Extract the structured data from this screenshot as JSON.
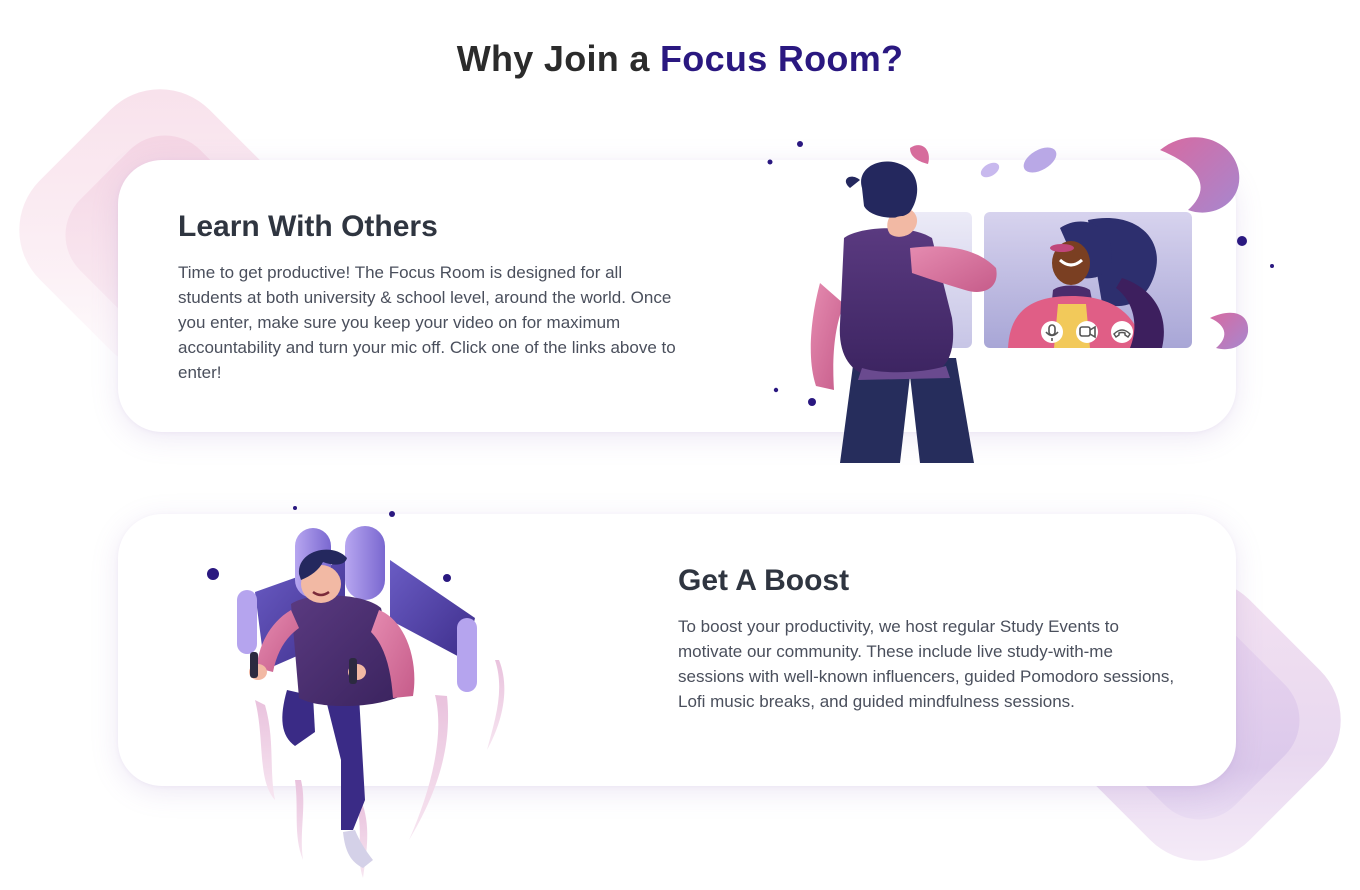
{
  "page": {
    "heading_part1": "Why Join a ",
    "heading_accent": "Focus Room?"
  },
  "features": [
    {
      "title": "Learn With Others",
      "text": "Time to get productive! The Focus Room is designed for all students at both university & school level, around the world. Once you enter, make sure you keep your video on for maximum accountability and turn your mic off. Click one of the links above to enter!",
      "illustration": "video-call-illustration"
    },
    {
      "title": "Get A Boost",
      "text": "To boost your productivity, we host regular Study Events to motivate our community. These include live study-with-me sessions with well-known influencers, guided Pomodoro sessions, Lofi music breaks, and guided mindfulness sessions.",
      "illustration": "jetpack-illustration"
    }
  ],
  "icons": [
    "microphone-icon",
    "camera-icon",
    "hang-up-icon"
  ],
  "colors": {
    "accent": "#2a1880",
    "heading": "#2b2b2b",
    "body_text": "#4a4f5c",
    "card_bg": "#ffffff",
    "pink": "#e06a8e",
    "purple": "#4b2c6e"
  }
}
